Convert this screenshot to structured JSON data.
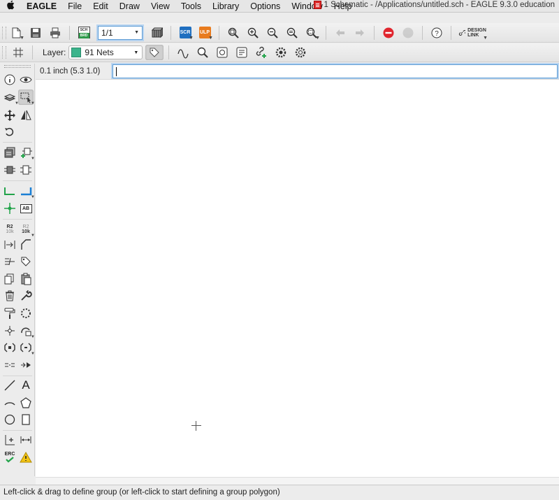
{
  "menubar": {
    "app_name": "EAGLE",
    "items": [
      "File",
      "Edit",
      "Draw",
      "View",
      "Tools",
      "Library",
      "Options",
      "Window",
      "Help"
    ],
    "window_title": "1 Schematic - /Applications/untitled.sch - EAGLE 9.3.0 education"
  },
  "toolbar": {
    "sheet_value": "1/1",
    "scr_label": "SCR",
    "ulp_label": "ULP",
    "sch_brd_label": "SCH BRD",
    "design_link_line1": "DESIGN",
    "design_link_line2": "LINK",
    "help_label": "?"
  },
  "layer_bar": {
    "label": "Layer:",
    "selected_layer": "91 Nets",
    "layer_color": "#3cb48c"
  },
  "command_row": {
    "coordinates": "0.1 inch (5.3 1.0)",
    "command_value": ""
  },
  "palette": {
    "r2_label": "R2",
    "r2_value": "10k",
    "ab_label": "AB",
    "erc_label": "ERC",
    "text_tool_label": "A"
  },
  "status": {
    "message": "Left-click & drag to define group (or left-click to start defining a group polygon)"
  },
  "colors": {
    "accent_blue": "#1a7fd4",
    "net_green": "#22a34a",
    "stop_red": "#e0262e",
    "warning_yellow": "#f3c414"
  }
}
